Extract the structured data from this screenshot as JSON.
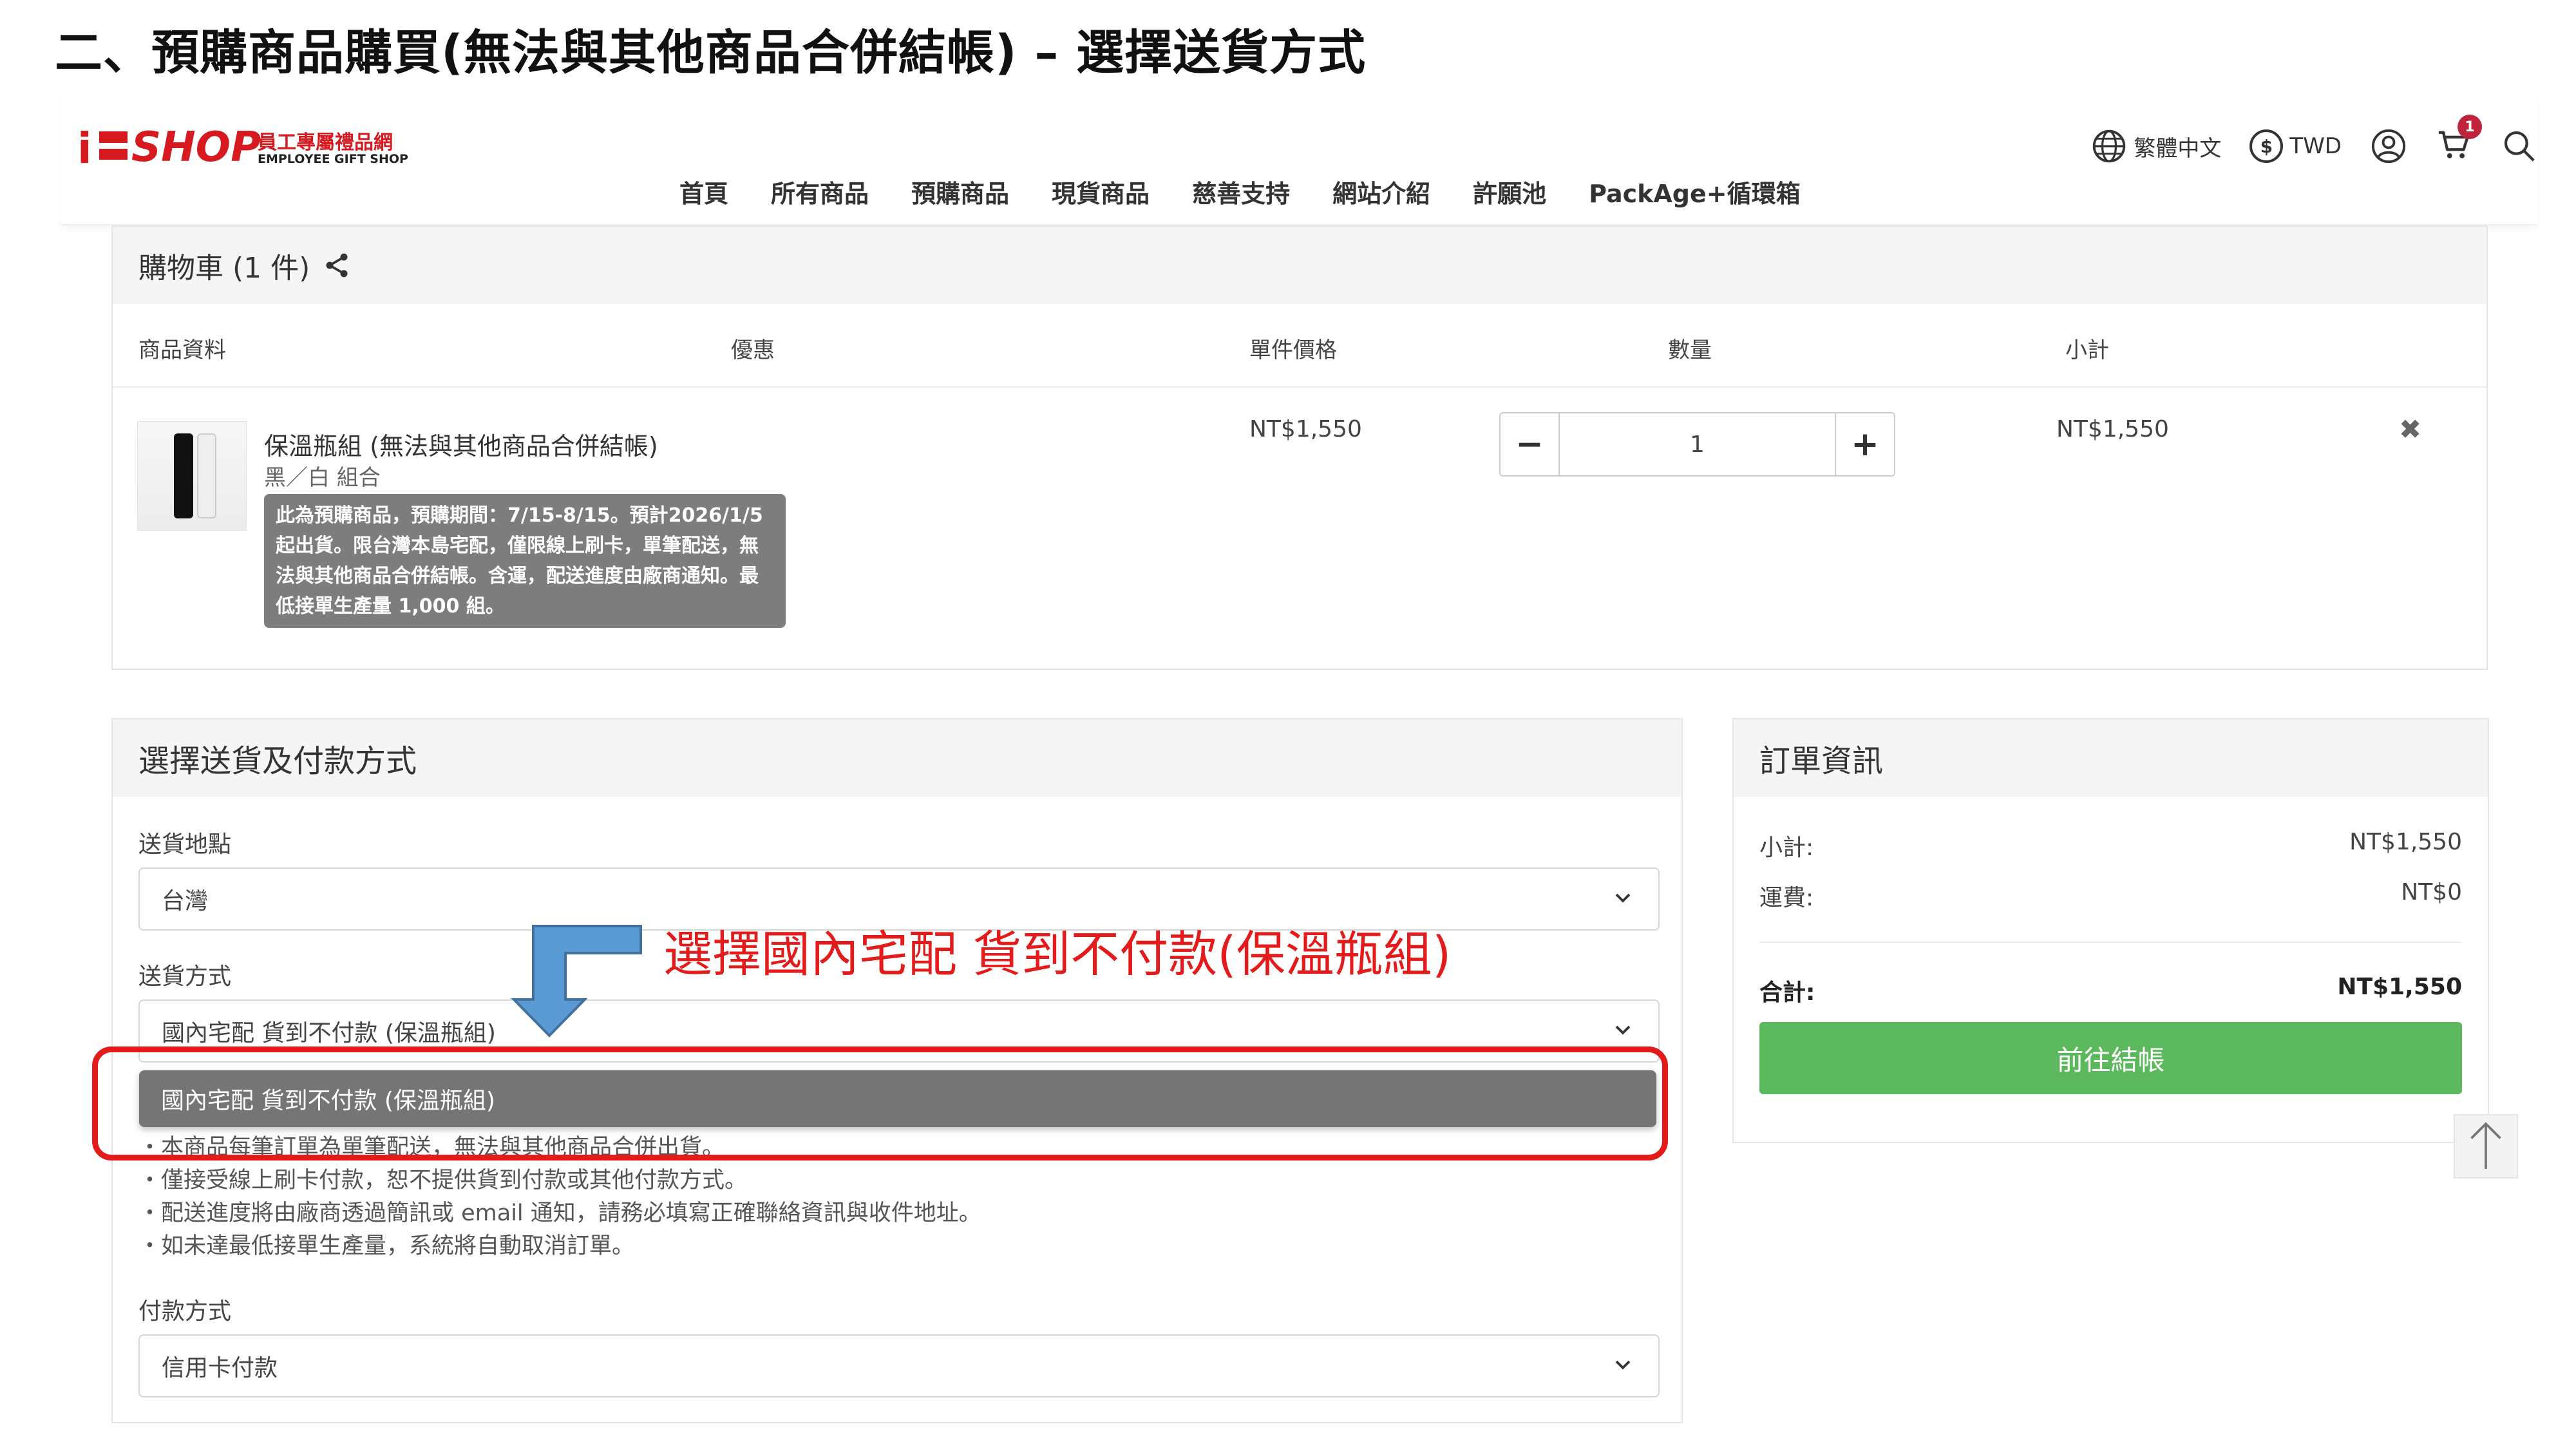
{
  "slide": {
    "title": "二、預購商品購買(無法與其他商品合併結帳) – 選擇送貨方式"
  },
  "logo": {
    "brand": "SHOP",
    "cn": "員工專屬禮品網",
    "en": "EMPLOYEE GIFT SHOP"
  },
  "nav": {
    "items": [
      "首頁",
      "所有商品",
      "預購商品",
      "現貨商品",
      "慈善支持",
      "網站介紹",
      "許願池",
      "PackAge+循環箱"
    ]
  },
  "header": {
    "language": "繁體中文",
    "currency": "TWD",
    "currency_symbol": "$",
    "cart_count": "1"
  },
  "cart": {
    "title": "購物車 (1 件)",
    "columns": {
      "info": "商品資料",
      "discount": "優惠",
      "unit_price": "單件價格",
      "quantity": "數量",
      "subtotal": "小計"
    },
    "item": {
      "name": "保溫瓶組 (無法與其他商品合併結帳)",
      "variant": "黑／白 組合",
      "note": "此為預購商品，預購期間：7/15-8/15。預計2026/1/5起出貨。限台灣本島宅配，僅限線上刷卡，單筆配送，無法與其他商品合併結帳。含運，配送進度由廠商通知。最低接單生產量 1,000 組。",
      "unit_price": "NT$1,550",
      "quantity": "1",
      "subtotal": "NT$1,550"
    }
  },
  "shipping": {
    "title": "選擇送貨及付款方式",
    "location_label": "送貨地點",
    "location_value": "台灣",
    "method_label": "送貨方式",
    "method_value": "國內宅配 貨到不付款 (保溫瓶組)",
    "dropdown_option": "國內宅配 貨到不付款 (保溫瓶組)",
    "notes": [
      "・本商品每筆訂單為單筆配送，無法與其他商品合併出貨。",
      "・僅接受線上刷卡付款，恕不提供貨到付款或其他付款方式。",
      "・配送進度將由廠商透過簡訊或 email 通知，請務必填寫正確聯絡資訊與收件地址。",
      "・如未達最低接單生產量，系統將自動取消訂單。"
    ],
    "payment_label": "付款方式",
    "payment_value": "信用卡付款"
  },
  "annotation": {
    "text": "選擇國內宅配 貨到不付款(保溫瓶組)",
    "color": "#e41b1b"
  },
  "order": {
    "title": "訂單資訊",
    "subtotal_label": "小計:",
    "subtotal_value": "NT$1,550",
    "shipping_label": "運費:",
    "shipping_value": "NT$0",
    "total_label": "合計:",
    "total_value": "NT$1,550",
    "checkout_label": "前往結帳"
  },
  "colors": {
    "brand": "#d71920",
    "checkout": "#5cb85c",
    "badge": "#c0243a",
    "annotation": "#e41b1b"
  },
  "icons": [
    "globe-icon",
    "dollar-icon",
    "user-icon",
    "cart-icon",
    "search-icon",
    "share-icon",
    "close-icon",
    "chevron-down-icon",
    "arrow-up-icon"
  ]
}
